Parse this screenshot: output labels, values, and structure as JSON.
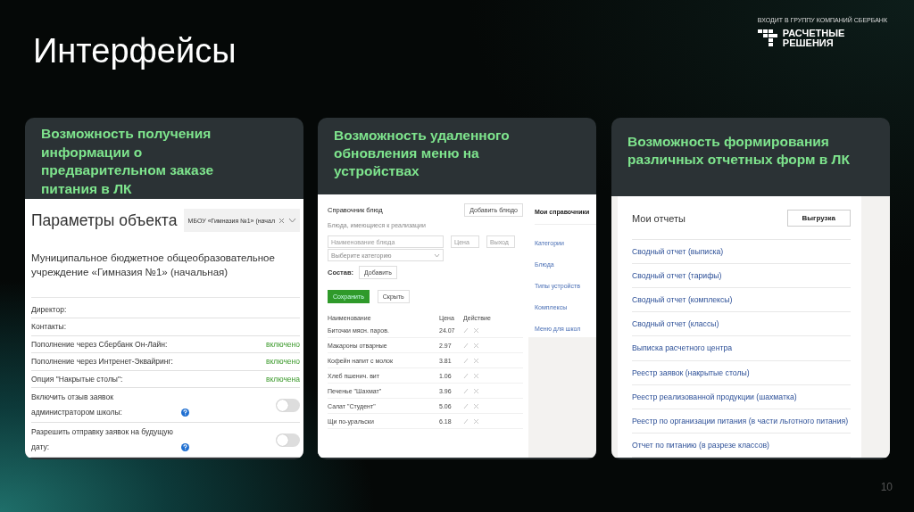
{
  "slide": {
    "title": "Интерфейсы",
    "page_number": "10"
  },
  "logo": {
    "tagline": "ВХОДИТ В ГРУППУ КОМПАНИЙ СБЕРБАНК",
    "line_1": "РАСЧЕТНЫЕ",
    "line_2": "РЕШЕНИЯ"
  },
  "cards": [
    {
      "kind": "object_params",
      "heading": "Возможность получения информации о предварительном заказе питания в ЛК",
      "screen": {
        "title": "Параметры объекта",
        "select_value": "МБОУ «Гимназия №1» (начал",
        "description": "Муниципальное бюджетное общеобразовательное учреждение «Гимназия №1» (начальная)",
        "rows": [
          {
            "kind": "text",
            "label": "Директор:"
          },
          {
            "kind": "text",
            "label": "Контакты:"
          },
          {
            "kind": "status",
            "label": "Пополнение через Сбербанк Он-Лайн:",
            "value": "включено"
          },
          {
            "kind": "status",
            "label": "Пополнение через Интренет-Эквайринг:",
            "value": "включено"
          },
          {
            "kind": "status",
            "label": "Опция \"Накрытые столы\":",
            "value": "включена"
          },
          {
            "kind": "toggle",
            "label": "Включить отзыв заявок администратором школы:",
            "on": false
          },
          {
            "kind": "toggle",
            "label": "Разрешить отправку заявок на будущую дату:",
            "on": false
          }
        ]
      }
    },
    {
      "kind": "dish_catalog",
      "heading": "Возможность удаленного обновления меню на устройствах",
      "screen": {
        "title": "Справочник блюд",
        "add_button": "Добавить блюдо",
        "subtitle": "Блюда, имеющиеся к реализации",
        "name_field": {
          "placeholder": "Наименование блюда"
        },
        "price_field": {
          "placeholder": "Цена"
        },
        "yield_field": {
          "placeholder": "Выход"
        },
        "category_select": {
          "placeholder": "Выберите категорию"
        },
        "composition_label": "Состав:",
        "composition_button": "Добавить",
        "save_button": "Сохранить",
        "hide_button": "Скрыть",
        "table": {
          "columns": [
            "Наименование",
            "Цена",
            "Действие"
          ],
          "rows": [
            {
              "name": "Биточки мясн. паров.",
              "price": "24.07"
            },
            {
              "name": "Макароны отварные",
              "price": "2.97"
            },
            {
              "name": "Кофейн напит с молок",
              "price": "3.81"
            },
            {
              "name": "Хлеб пшенич. вит",
              "price": "1.06"
            },
            {
              "name": "Печенье \"Шахмат\"",
              "price": "3.96"
            },
            {
              "name": "Салат \"Студент\"",
              "price": "5.06"
            },
            {
              "name": "Щи по-уральски",
              "price": "6.18"
            }
          ]
        },
        "sidebar": {
          "title": "Мои справочники",
          "items": [
            "Категории",
            "Блюда",
            "Типы устройств",
            "Комплексы",
            "Меню для школ"
          ]
        }
      }
    },
    {
      "kind": "reports",
      "heading": "Возможность формирования различных отчетных форм в ЛК",
      "screen": {
        "title": "Мои отчеты",
        "export_button": "Выгрузка",
        "items": [
          "Сводный отчет (выписка)",
          "Сводный отчет (тарифы)",
          "Сводный отчет (комплексы)",
          "Сводный отчет (классы)",
          "Выписка расчетного центра",
          "Реестр заявок (накрытые столы)",
          "Реестр реализованной продукции (шахматка)",
          "Реестр по организации питания (в части льготного питания)",
          "Отчет по питанию (в разрезе классов)"
        ]
      }
    }
  ]
}
